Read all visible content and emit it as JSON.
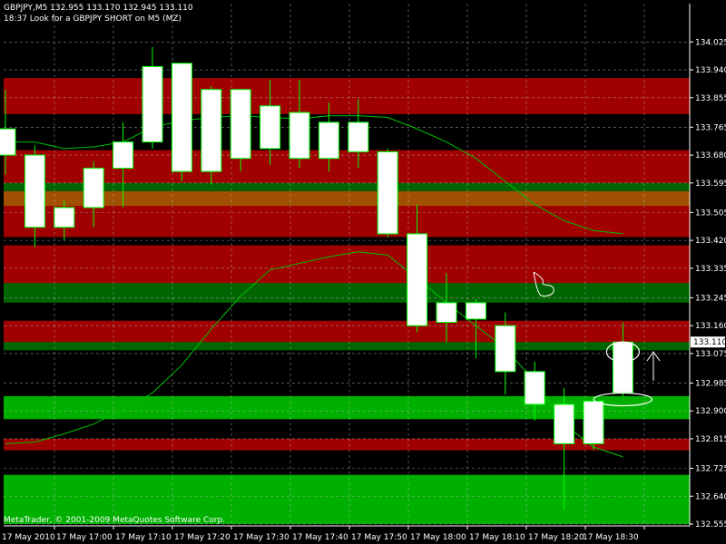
{
  "header": {
    "symbol_line": "GBPJPY,M5  132.955 133.170 132.945 133.110",
    "note_line": "18:37 Look for a GBPJPY SHORT on M5 (MZ)"
  },
  "footer": {
    "copyright": "MetaTrader, © 2001-2009 MetaQuotes Software Corp."
  },
  "colors": {
    "background": "#000000",
    "grid": "#c0c0c0",
    "bull_fill": "#ffffff",
    "bear_fill": "#000000",
    "candle_outline": "#00ff00",
    "zone_red": "#a00000",
    "zone_green": "#006400",
    "zone_bright_green": "#00b000",
    "zone_orange": "#a05000",
    "ma_line": "#00c000",
    "price_label_bg": "#ffffff",
    "axis_text": "#ffffff"
  },
  "chart_data": {
    "type": "candlestick",
    "symbol": "GBPJPY",
    "timeframe": "M5",
    "ylim": [
      132.555,
      134.07
    ],
    "y_ticks": [
      "134.025",
      "133.940",
      "133.855",
      "133.765",
      "133.680",
      "133.595",
      "133.505",
      "133.420",
      "133.335",
      "133.245",
      "133.160",
      "133.075",
      "132.985",
      "132.900",
      "132.815",
      "132.725",
      "132.640",
      "132.555"
    ],
    "x_ticks": [
      "17 May 2010",
      "17 May 17:00",
      "17 May 17:10",
      "17 May 17:20",
      "17 May 17:30",
      "17 May 17:40",
      "17 May 17:50",
      "17 May 18:00",
      "17 May 18:10",
      "17 May 18:20",
      "17 May 18:30"
    ],
    "current_price": "133.110",
    "candles": [
      {
        "o": 133.68,
        "h": 133.88,
        "l": 133.62,
        "c": 133.76
      },
      {
        "o": 133.46,
        "h": 133.71,
        "l": 133.4,
        "c": 133.68
      },
      {
        "o": 133.46,
        "h": 133.54,
        "l": 133.42,
        "c": 133.52
      },
      {
        "o": 133.52,
        "h": 133.66,
        "l": 133.46,
        "c": 133.64
      },
      {
        "o": 133.64,
        "h": 133.78,
        "l": 133.52,
        "c": 133.72
      },
      {
        "o": 133.72,
        "h": 134.01,
        "l": 133.7,
        "c": 133.95
      },
      {
        "o": 133.63,
        "h": 133.96,
        "l": 133.6,
        "c": 133.96
      },
      {
        "o": 133.63,
        "h": 133.89,
        "l": 133.59,
        "c": 133.88
      },
      {
        "o": 133.67,
        "h": 133.88,
        "l": 133.63,
        "c": 133.88
      },
      {
        "o": 133.7,
        "h": 133.91,
        "l": 133.65,
        "c": 133.83
      },
      {
        "o": 133.67,
        "h": 133.91,
        "l": 133.64,
        "c": 133.81
      },
      {
        "o": 133.67,
        "h": 133.84,
        "l": 133.63,
        "c": 133.78
      },
      {
        "o": 133.69,
        "h": 133.85,
        "l": 133.64,
        "c": 133.78
      },
      {
        "o": 133.44,
        "h": 133.7,
        "l": 133.43,
        "c": 133.69
      },
      {
        "o": 133.16,
        "h": 133.53,
        "l": 133.14,
        "c": 133.44
      },
      {
        "o": 133.17,
        "h": 133.32,
        "l": 133.11,
        "c": 133.23
      },
      {
        "o": 133.18,
        "h": 133.24,
        "l": 133.06,
        "c": 133.23
      },
      {
        "o": 133.02,
        "h": 133.2,
        "l": 132.95,
        "c": 133.16
      },
      {
        "o": 132.92,
        "h": 133.05,
        "l": 132.87,
        "c": 133.02
      },
      {
        "o": 132.8,
        "h": 132.97,
        "l": 132.6,
        "c": 132.92
      },
      {
        "o": 132.8,
        "h": 132.94,
        "l": 132.78,
        "c": 132.93
      },
      {
        "o": 132.955,
        "h": 133.17,
        "l": 132.945,
        "c": 133.11
      }
    ],
    "zones": [
      {
        "color": "red",
        "from": 133.805,
        "to": 133.915
      },
      {
        "color": "red",
        "from": 133.54,
        "to": 133.695
      },
      {
        "color": "red",
        "from": 133.43,
        "to": 133.545
      },
      {
        "color": "orange",
        "from": 133.525,
        "to": 133.57
      },
      {
        "color": "green",
        "from": 133.57,
        "to": 133.595
      },
      {
        "color": "green",
        "from": 133.23,
        "to": 133.365
      },
      {
        "color": "red",
        "from": 133.29,
        "to": 133.405
      },
      {
        "color": "red",
        "from": 133.1,
        "to": 133.175
      },
      {
        "color": "green",
        "from": 133.085,
        "to": 133.11
      },
      {
        "color": "bright_green",
        "from": 132.875,
        "to": 132.945
      },
      {
        "color": "red",
        "from": 132.78,
        "to": 132.815
      },
      {
        "color": "bright_green",
        "from": 132.555,
        "to": 132.705
      }
    ],
    "ma_fast": [
      133.72,
      133.72,
      133.7,
      133.705,
      133.72,
      133.765,
      133.785,
      133.795,
      133.8,
      133.795,
      133.79,
      133.8,
      133.8,
      133.795,
      133.76,
      133.72,
      133.67,
      133.6,
      133.53,
      133.48,
      133.45,
      133.44
    ],
    "ma_slow": [
      132.8,
      132.805,
      132.83,
      132.86,
      132.905,
      132.955,
      133.04,
      133.15,
      133.25,
      133.33,
      133.35,
      133.37,
      133.385,
      133.375,
      133.305,
      133.23,
      133.16,
      133.09,
      132.99,
      132.86,
      132.79,
      132.76
    ]
  }
}
